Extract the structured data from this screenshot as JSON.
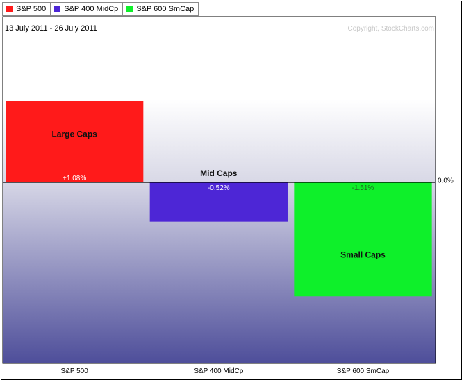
{
  "legend": [
    {
      "label": "S&P 500",
      "color": "#ff1a1a"
    },
    {
      "label": "S&P 400 MidCp",
      "color": "#4d26d6"
    },
    {
      "label": "S&P 600 SmCap",
      "color": "#0ef02a"
    }
  ],
  "date_range": "13 July 2011 - 26 July 2011",
  "copyright": "Copyright, StockCharts.com",
  "chart_data": {
    "type": "bar",
    "categories": [
      "S&P 500",
      "S&P 400 MidCp",
      "S&P 600 SmCap"
    ],
    "values": [
      1.08,
      -0.52,
      -1.51
    ],
    "value_labels": [
      "+1.08%",
      "-0.52%",
      "-1.51%"
    ],
    "bar_captions": [
      "Large Caps",
      "Mid Caps",
      "Small Caps"
    ],
    "colors": [
      "#ff1a1a",
      "#4d26d6",
      "#0ef02a"
    ],
    "zero_label": "0.0%",
    "ylim": [
      -2.4,
      2.2
    ],
    "grid": false
  }
}
